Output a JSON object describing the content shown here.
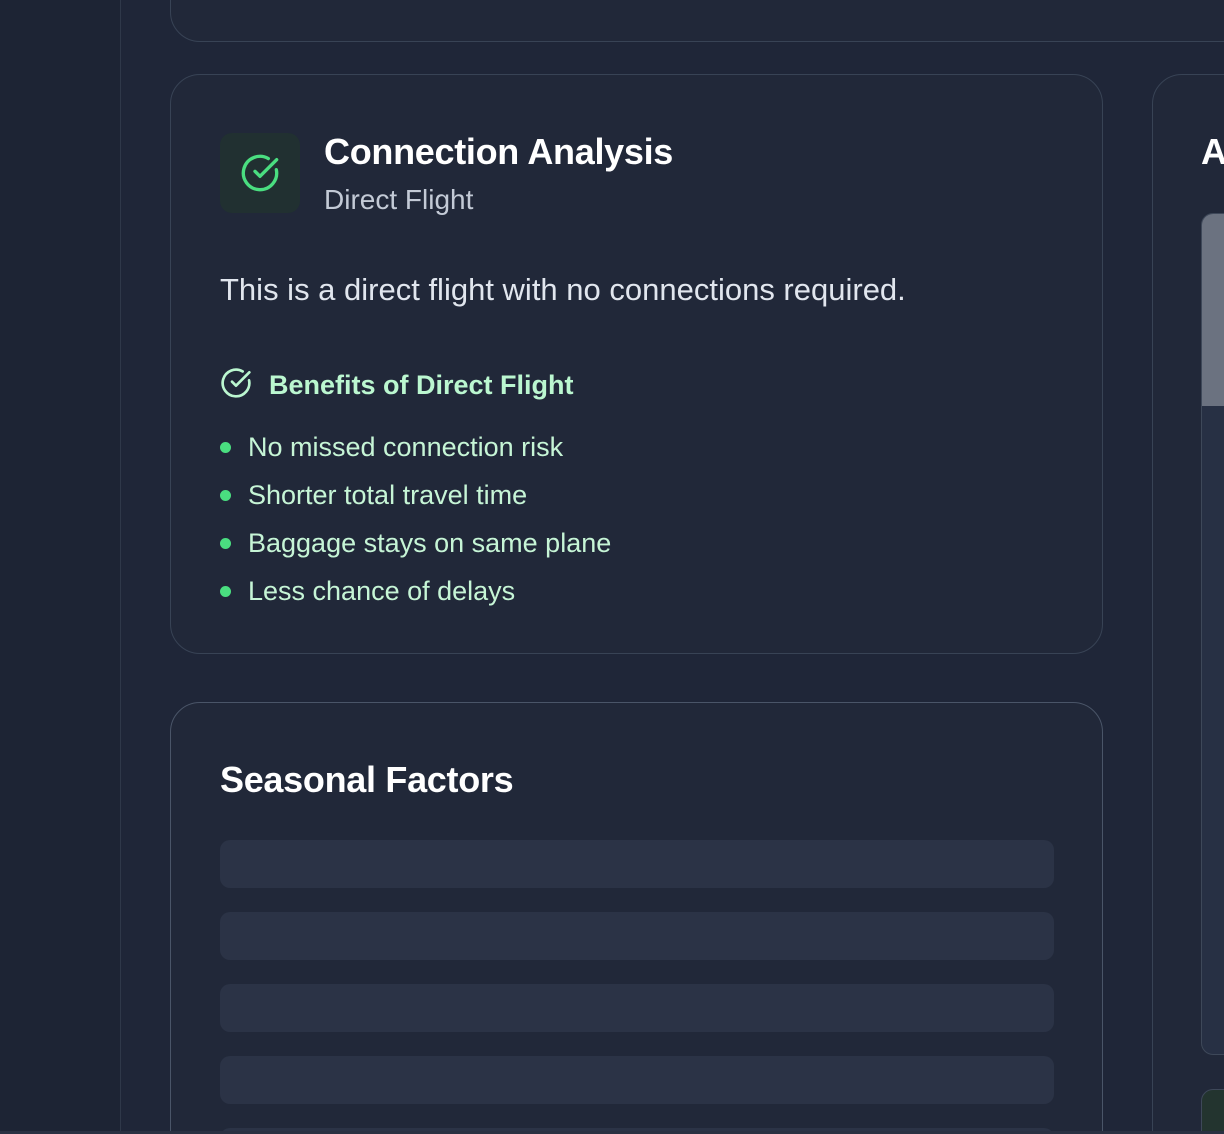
{
  "connection": {
    "title": "Connection Analysis",
    "subtitle": "Direct Flight",
    "description": "This is a direct flight with no connections required.",
    "benefits_title": "Benefits of Direct Flight",
    "benefits": [
      "No missed connection risk",
      "Shorter total travel time",
      "Baggage stays on same plane",
      "Less chance of delays"
    ]
  },
  "seasonal": {
    "title": "Seasonal Factors"
  },
  "right_card": {
    "title_fragment": "A"
  },
  "icons": {
    "status_icon": "check-circle-icon",
    "benefits_icon": "check-circle-icon"
  },
  "colors": {
    "accent_green": "#4ade80",
    "benefit_text": "#bbf7d0"
  }
}
